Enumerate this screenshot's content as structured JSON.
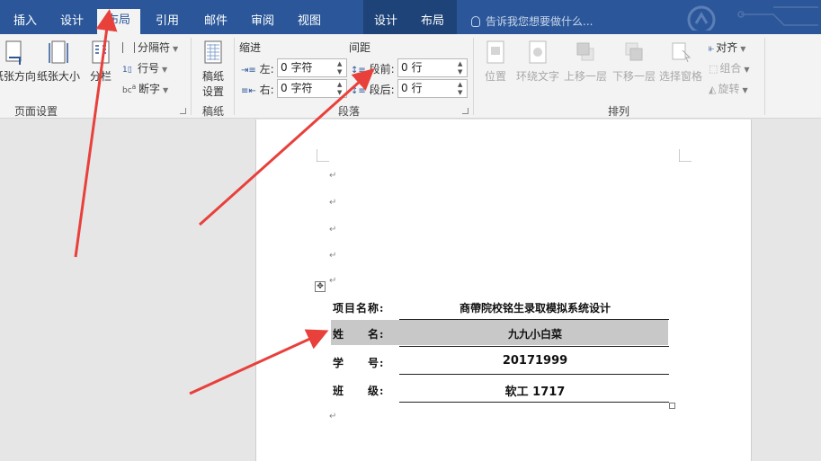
{
  "tabs": [
    {
      "label": "插入"
    },
    {
      "label": "设计"
    },
    {
      "label": "布局"
    },
    {
      "label": "引用"
    },
    {
      "label": "邮件"
    },
    {
      "label": "审阅"
    },
    {
      "label": "视图"
    }
  ],
  "context_tabs": [
    {
      "label": "设计"
    },
    {
      "label": "布局"
    }
  ],
  "tell_me": "告诉我您想要做什么...",
  "ribbon": {
    "page_setup": {
      "orientation": "纸张方向",
      "size": "纸张大小",
      "columns": "分栏",
      "breaks": "分隔符",
      "line_numbers": "行号",
      "hyphenation": "断字",
      "label": "页面设置"
    },
    "manuscript": {
      "button_line1": "稿纸",
      "button_line2": "设置",
      "label": "稿纸"
    },
    "paragraph": {
      "indent_title": "缩进",
      "spacing_title": "间距",
      "left_label": "左:",
      "right_label": "右:",
      "before_label": "段前:",
      "after_label": "段后:",
      "left_value": "0 字符",
      "right_value": "0 字符",
      "before_value": "0 行",
      "after_value": "0 行",
      "label": "段落"
    },
    "arrange": {
      "position": "位置",
      "wrap_text": "环绕文字",
      "bring_forward": "上移一层",
      "send_backward": "下移一层",
      "selection_pane": "选择窗格",
      "align": "对齐",
      "group": "组合",
      "rotate": "旋转",
      "label": "排列"
    }
  },
  "document": {
    "paragraph_mark": "↵",
    "table": [
      {
        "label": "项目名称:",
        "value": "商帶院校铭生录取模拟系统设计"
      },
      {
        "label": "姓　　名:",
        "value": "九九小白菜"
      },
      {
        "label": "学　　号:",
        "value": "20171999"
      },
      {
        "label": "班　　级:",
        "value": "软工 1717"
      }
    ]
  },
  "colors": {
    "ribbon_blue": "#2b579a",
    "annotation_red": "#e8403b",
    "highlight_row": "#c8c8c8"
  }
}
